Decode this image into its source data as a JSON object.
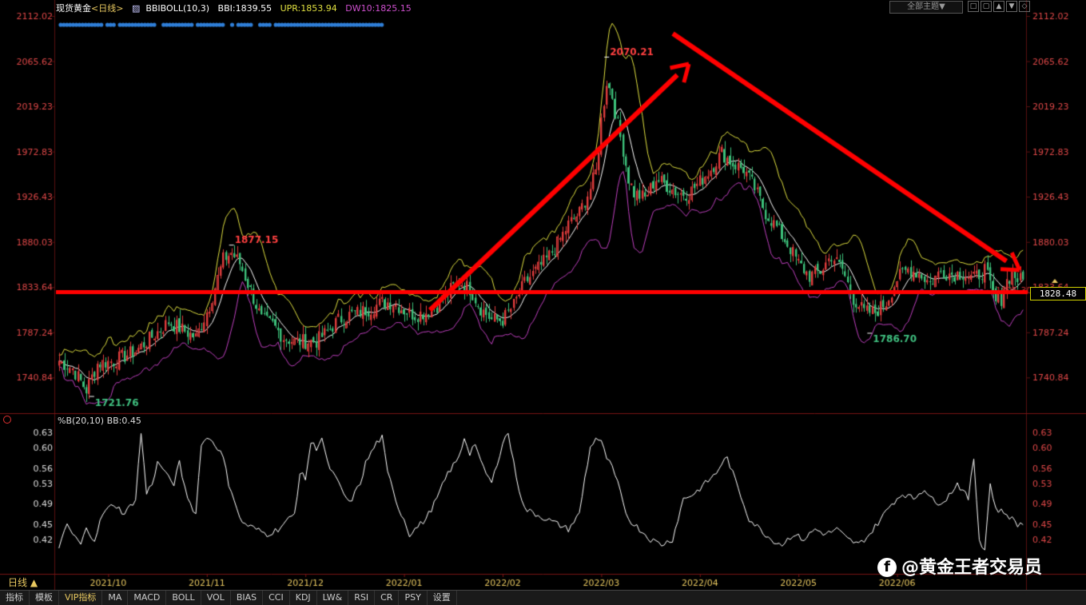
{
  "header": {
    "instrument": "现货黄金",
    "period_tag": "<日线>",
    "indicator_name": "BBIBOLL(10,3)",
    "bbi": "BBI:1839.55",
    "upr": "UPR:1853.94",
    "dw": "DW10:1825.15",
    "theme_dropdown": "全部主题▼"
  },
  "colors": {
    "up": "#e03c3c",
    "down": "#3cc07a",
    "bbi": "#ffffff",
    "upr": "#e0e040",
    "dw": "#c040c0",
    "annotation": "#ff0000",
    "axis_text": "#e04848"
  },
  "price_box": "1828.48",
  "current_price_label": "1825.30",
  "period_button": "日线 ▲",
  "sub_indicator_label": "%B(20,10) BB:0.45",
  "tabs": [
    "指标",
    "模板",
    "VIP指标",
    "MA",
    "MACD",
    "BOLL",
    "VOL",
    "BIAS",
    "CCI",
    "KDJ",
    "LW&",
    "RSI",
    "CR",
    "PSY",
    "设置"
  ],
  "watermark": "@黄金王者交易员",
  "chart_data": [
    {
      "type": "candlestick",
      "y_ticks": [
        2112.02,
        2065.62,
        2019.23,
        1972.83,
        1926.43,
        1880.03,
        1833.64,
        1787.24,
        1740.84
      ],
      "ylim": [
        1705,
        2112.02
      ],
      "x_ticks": [
        "2021/10",
        "2021/11",
        "2021/12",
        "2022/01",
        "2022/02",
        "2022/03",
        "2022/04",
        "2022/05",
        "2022/06"
      ],
      "annotations": [
        {
          "label": "2070.21",
          "value": 2070.21,
          "kind": "high"
        },
        {
          "label": "1877.15",
          "value": 1877.15,
          "kind": "high"
        },
        {
          "label": "1721.76",
          "value": 1721.76,
          "kind": "low"
        },
        {
          "label": "1786.70",
          "value": 1786.7,
          "kind": "low"
        }
      ],
      "horizontal_line": 1828.48,
      "close_anchors": [
        [
          0,
          1758
        ],
        [
          5,
          1750
        ],
        [
          10,
          1728
        ],
        [
          14,
          1755
        ],
        [
          20,
          1758
        ],
        [
          28,
          1768
        ],
        [
          35,
          1785
        ],
        [
          40,
          1798
        ],
        [
          45,
          1790
        ],
        [
          50,
          1782
        ],
        [
          55,
          1815
        ],
        [
          60,
          1862
        ],
        [
          63,
          1869
        ],
        [
          66,
          1858
        ],
        [
          70,
          1830
        ],
        [
          74,
          1800
        ],
        [
          78,
          1795
        ],
        [
          82,
          1782
        ],
        [
          86,
          1778
        ],
        [
          90,
          1778
        ],
        [
          94,
          1778
        ],
        [
          98,
          1788
        ],
        [
          102,
          1800
        ],
        [
          106,
          1805
        ],
        [
          110,
          1808
        ],
        [
          114,
          1812
        ],
        [
          118,
          1818
        ],
        [
          122,
          1818
        ],
        [
          126,
          1810
        ],
        [
          130,
          1805
        ],
        [
          134,
          1808
        ],
        [
          138,
          1815
        ],
        [
          142,
          1828
        ],
        [
          146,
          1840
        ],
        [
          150,
          1832
        ],
        [
          154,
          1812
        ],
        [
          158,
          1800
        ],
        [
          162,
          1800
        ],
        [
          166,
          1815
        ],
        [
          170,
          1838
        ],
        [
          174,
          1850
        ],
        [
          178,
          1862
        ],
        [
          182,
          1878
        ],
        [
          186,
          1898
        ],
        [
          190,
          1910
        ],
        [
          194,
          1935
        ],
        [
          196,
          1952
        ],
        [
          198,
          2005
        ],
        [
          200,
          2045
        ],
        [
          202,
          2030
        ],
        [
          204,
          2000
        ],
        [
          206,
          1975
        ],
        [
          208,
          1945
        ],
        [
          210,
          1930
        ],
        [
          214,
          1925
        ],
        [
          218,
          1945
        ],
        [
          222,
          1938
        ],
        [
          226,
          1930
        ],
        [
          230,
          1930
        ],
        [
          234,
          1942
        ],
        [
          238,
          1955
        ],
        [
          242,
          1972
        ],
        [
          246,
          1960
        ],
        [
          250,
          1955
        ],
        [
          254,
          1935
        ],
        [
          258,
          1910
        ],
        [
          262,
          1895
        ],
        [
          266,
          1878
        ],
        [
          270,
          1858
        ],
        [
          274,
          1845
        ],
        [
          278,
          1850
        ],
        [
          282,
          1866
        ],
        [
          286,
          1852
        ],
        [
          290,
          1822
        ],
        [
          294,
          1808
        ],
        [
          298,
          1808
        ],
        [
          302,
          1818
        ],
        [
          306,
          1842
        ],
        [
          310,
          1852
        ],
        [
          314,
          1848
        ],
        [
          318,
          1838
        ],
        [
          322,
          1850
        ],
        [
          326,
          1847
        ],
        [
          330,
          1848
        ],
        [
          334,
          1842
        ],
        [
          338,
          1852
        ],
        [
          342,
          1818
        ],
        [
          344,
          1822
        ],
        [
          346,
          1840
        ],
        [
          348,
          1848
        ],
        [
          350,
          1842
        ],
        [
          352,
          1840
        ]
      ]
    },
    {
      "type": "line",
      "name": "%B(20,10)",
      "y_ticks": [
        0.63,
        0.6,
        0.56,
        0.53,
        0.49,
        0.45,
        0.42
      ],
      "ylim": [
        0.39,
        0.635
      ],
      "anchors": [
        [
          0,
          0.4
        ],
        [
          3,
          0.45
        ],
        [
          5,
          0.43
        ],
        [
          8,
          0.41
        ],
        [
          10,
          0.44
        ],
        [
          13,
          0.42
        ],
        [
          16,
          0.47
        ],
        [
          20,
          0.49
        ],
        [
          24,
          0.47
        ],
        [
          28,
          0.5
        ],
        [
          30,
          0.63
        ],
        [
          32,
          0.51
        ],
        [
          34,
          0.53
        ],
        [
          36,
          0.57
        ],
        [
          38,
          0.56
        ],
        [
          40,
          0.54
        ],
        [
          42,
          0.53
        ],
        [
          44,
          0.57
        ],
        [
          46,
          0.52
        ],
        [
          48,
          0.49
        ],
        [
          50,
          0.47
        ],
        [
          52,
          0.61
        ],
        [
          55,
          0.62
        ],
        [
          58,
          0.6
        ],
        [
          60,
          0.58
        ],
        [
          62,
          0.53
        ],
        [
          64,
          0.5
        ],
        [
          66,
          0.46
        ],
        [
          68,
          0.45
        ],
        [
          72,
          0.44
        ],
        [
          76,
          0.43
        ],
        [
          80,
          0.44
        ],
        [
          84,
          0.46
        ],
        [
          86,
          0.47
        ],
        [
          88,
          0.55
        ],
        [
          90,
          0.54
        ],
        [
          92,
          0.61
        ],
        [
          94,
          0.6
        ],
        [
          96,
          0.62
        ],
        [
          98,
          0.57
        ],
        [
          100,
          0.55
        ],
        [
          102,
          0.53
        ],
        [
          104,
          0.51
        ],
        [
          106,
          0.49
        ],
        [
          108,
          0.51
        ],
        [
          110,
          0.53
        ],
        [
          112,
          0.57
        ],
        [
          114,
          0.59
        ],
        [
          116,
          0.61
        ],
        [
          118,
          0.62
        ],
        [
          120,
          0.55
        ],
        [
          122,
          0.52
        ],
        [
          124,
          0.48
        ],
        [
          126,
          0.46
        ],
        [
          128,
          0.43
        ],
        [
          130,
          0.44
        ],
        [
          134,
          0.46
        ],
        [
          138,
          0.5
        ],
        [
          142,
          0.55
        ],
        [
          146,
          0.58
        ],
        [
          148,
          0.62
        ],
        [
          150,
          0.59
        ],
        [
          152,
          0.61
        ],
        [
          154,
          0.57
        ],
        [
          156,
          0.55
        ],
        [
          158,
          0.53
        ],
        [
          160,
          0.57
        ],
        [
          162,
          0.61
        ],
        [
          164,
          0.63
        ],
        [
          166,
          0.57
        ],
        [
          168,
          0.52
        ],
        [
          170,
          0.48
        ],
        [
          174,
          0.47
        ],
        [
          178,
          0.46
        ],
        [
          182,
          0.45
        ],
        [
          186,
          0.44
        ],
        [
          190,
          0.47
        ],
        [
          192,
          0.54
        ],
        [
          194,
          0.6
        ],
        [
          196,
          0.62
        ],
        [
          198,
          0.61
        ],
        [
          200,
          0.58
        ],
        [
          202,
          0.56
        ],
        [
          204,
          0.53
        ],
        [
          206,
          0.49
        ],
        [
          208,
          0.46
        ],
        [
          212,
          0.44
        ],
        [
          216,
          0.42
        ],
        [
          220,
          0.41
        ],
        [
          224,
          0.42
        ],
        [
          226,
          0.46
        ],
        [
          228,
          0.5
        ],
        [
          232,
          0.51
        ],
        [
          236,
          0.53
        ],
        [
          240,
          0.55
        ],
        [
          242,
          0.57
        ],
        [
          244,
          0.58
        ],
        [
          246,
          0.55
        ],
        [
          248,
          0.52
        ],
        [
          250,
          0.49
        ],
        [
          252,
          0.46
        ],
        [
          256,
          0.44
        ],
        [
          260,
          0.42
        ],
        [
          264,
          0.41
        ],
        [
          268,
          0.43
        ],
        [
          272,
          0.42
        ],
        [
          276,
          0.44
        ],
        [
          280,
          0.43
        ],
        [
          284,
          0.44
        ],
        [
          288,
          0.42
        ],
        [
          292,
          0.41
        ],
        [
          296,
          0.43
        ],
        [
          300,
          0.46
        ],
        [
          304,
          0.49
        ],
        [
          308,
          0.51
        ],
        [
          312,
          0.5
        ],
        [
          316,
          0.52
        ],
        [
          320,
          0.49
        ],
        [
          324,
          0.5
        ],
        [
          328,
          0.53
        ],
        [
          332,
          0.5
        ],
        [
          334,
          0.58
        ],
        [
          336,
          0.42
        ],
        [
          338,
          0.4
        ],
        [
          340,
          0.53
        ],
        [
          342,
          0.48
        ],
        [
          346,
          0.47
        ],
        [
          350,
          0.45
        ]
      ]
    }
  ]
}
